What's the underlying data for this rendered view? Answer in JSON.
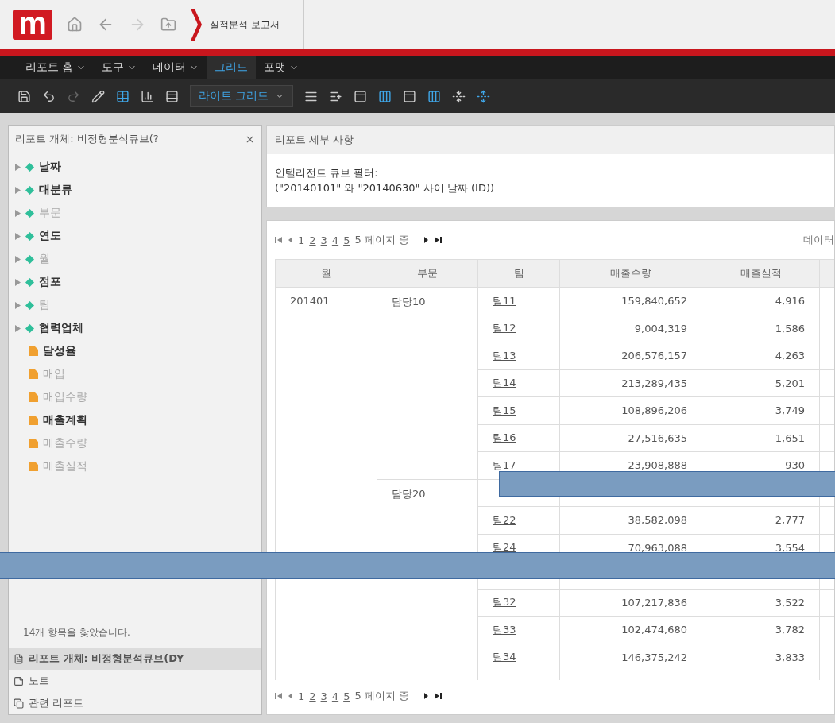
{
  "header": {
    "logo": "m",
    "breadcrumb": "실적분석 보고서"
  },
  "menu": [
    {
      "label": "리포트 홈",
      "dropdown": true,
      "selected": false
    },
    {
      "label": "도구",
      "dropdown": true,
      "selected": false
    },
    {
      "label": "데이터",
      "dropdown": true,
      "selected": false
    },
    {
      "label": "그리드",
      "dropdown": false,
      "selected": true
    },
    {
      "label": "포맷",
      "dropdown": true,
      "selected": false
    }
  ],
  "toolbar": [
    {
      "kind": "save",
      "disabled": false
    },
    {
      "kind": "undo",
      "disabled": false
    },
    {
      "kind": "redo",
      "disabled": true
    },
    {
      "kind": "pencil",
      "disabled": false
    },
    {
      "kind": "grid",
      "disabled": false
    },
    {
      "kind": "chart",
      "disabled": false
    },
    {
      "kind": "split",
      "disabled": false
    },
    {
      "kind": "style",
      "label": "라이트 그리드"
    },
    {
      "kind": "lines",
      "disabled": false
    },
    {
      "kind": "insert",
      "disabled": false
    },
    {
      "kind": "panel",
      "disabled": false
    },
    {
      "kind": "column",
      "disabled": false
    },
    {
      "kind": "panel",
      "disabled": false
    },
    {
      "kind": "column",
      "disabled": false
    },
    {
      "kind": "merge",
      "disabled": false
    },
    {
      "kind": "merge2",
      "disabled": false
    }
  ],
  "sidebar": {
    "title": "리포트 개체: 비정형분석큐브(?",
    "items": [
      {
        "kind": "attribute",
        "label": "날짜",
        "dimmed": false
      },
      {
        "kind": "attribute",
        "label": "대분류",
        "dimmed": false
      },
      {
        "kind": "attribute",
        "label": "부문",
        "dimmed": true
      },
      {
        "kind": "attribute",
        "label": "연도",
        "dimmed": false
      },
      {
        "kind": "attribute",
        "label": "월",
        "dimmed": true
      },
      {
        "kind": "attribute",
        "label": "점포",
        "dimmed": false
      },
      {
        "kind": "attribute",
        "label": "팀",
        "dimmed": true
      },
      {
        "kind": "attribute",
        "label": "협력업체",
        "dimmed": false
      },
      {
        "kind": "metric",
        "label": "달성율",
        "dimmed": false
      },
      {
        "kind": "metric",
        "label": "매입",
        "dimmed": true
      },
      {
        "kind": "metric",
        "label": "매입수량",
        "dimmed": true
      },
      {
        "kind": "metric",
        "label": "매출계획",
        "dimmed": false
      },
      {
        "kind": "metric",
        "label": "매출수량",
        "dimmed": true
      },
      {
        "kind": "metric",
        "label": "매출실적",
        "dimmed": true
      }
    ],
    "status": "14개 항목을 찾았습니다.",
    "sections": [
      {
        "kind": "objects",
        "label": "리포트 개체: 비정형분석큐브(DY",
        "selected": true
      },
      {
        "kind": "notes",
        "label": "노트",
        "selected": false
      },
      {
        "kind": "related",
        "label": "관련 리포트",
        "selected": false
      }
    ]
  },
  "details": {
    "title": "리포트 세부 사항",
    "filter_label": "인텔리전트 큐브 필터:",
    "filter_text": "(\"20140101\" 와 \"20140630\" 사이 날짜 (ID))"
  },
  "pager_top": {
    "pages": [
      {
        "label": "1",
        "selected": true
      },
      {
        "label": "2",
        "selected": false
      },
      {
        "label": "3",
        "selected": false
      },
      {
        "label": "4",
        "selected": false
      },
      {
        "label": "5",
        "selected": false
      }
    ],
    "summary": "5 페이지 중",
    "right_text": "데이터"
  },
  "table": {
    "columns": [
      "월",
      "부문",
      "팀",
      "매출수량",
      "매출실적"
    ],
    "months": [
      {
        "month": "201401",
        "divisions": [
          {
            "division": "담당10",
            "rows": [
              {
                "team": "팀11",
                "qty": "159,840,652",
                "amount": "4,916"
              },
              {
                "team": "팀12",
                "qty": "9,004,319",
                "amount": "1,586"
              },
              {
                "team": "팀13",
                "qty": "206,576,157",
                "amount": "4,263"
              },
              {
                "team": "팀14",
                "qty": "213,289,435",
                "amount": "5,201"
              },
              {
                "team": "팀15",
                "qty": "108,896,206",
                "amount": "3,749"
              },
              {
                "team": "팀16",
                "qty": "27,516,635",
                "amount": "1,651"
              },
              {
                "team": "팀17",
                "qty": "23,908,888",
                "amount": "930"
              }
            ]
          },
          {
            "division": "담당20",
            "rows": [
              {},
              {
                "team": "팀22",
                "qty": "38,582,098",
                "amount": "2,777"
              },
              {
                "team": "팀24",
                "qty": "70,963,088",
                "amount": "3,554"
              }
            ]
          },
          {
            "rows": [
              {},
              {
                "team": "팀32",
                "qty": "107,217,836",
                "amount": "3,522"
              },
              {
                "team": "팀33",
                "qty": "102,474,680",
                "amount": "3,782"
              },
              {
                "team": "팀34",
                "qty": "146,375,242",
                "amount": "3,833"
              },
              {}
            ]
          }
        ]
      }
    ]
  },
  "pager_bottom": {
    "pages": [
      {
        "label": "1",
        "selected": true
      },
      {
        "label": "2",
        "selected": false
      },
      {
        "label": "3",
        "selected": false
      },
      {
        "label": "4",
        "selected": false
      },
      {
        "label": "5",
        "selected": false
      }
    ],
    "summary": "5 페이지 중"
  }
}
